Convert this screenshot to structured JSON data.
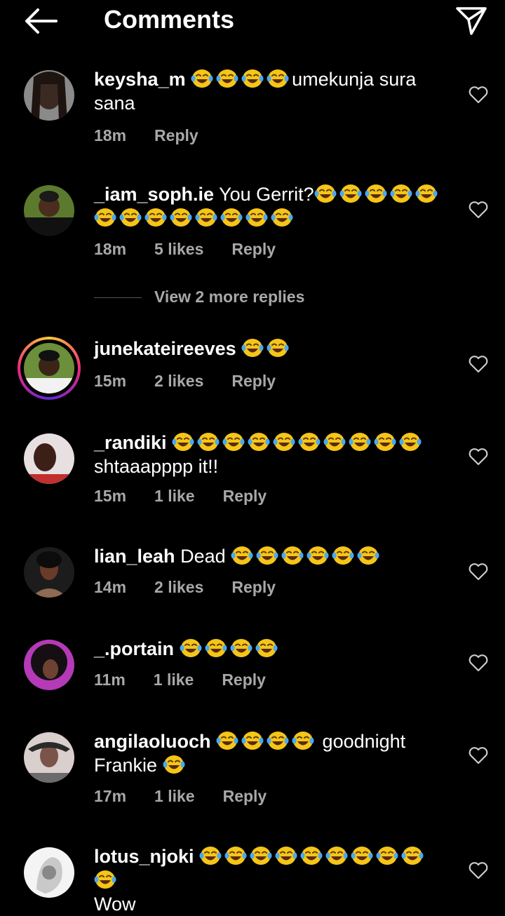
{
  "header": {
    "title": "Comments",
    "back_icon": "arrow-left-icon",
    "send_icon": "paper-plane-icon"
  },
  "comments": [
    {
      "user": "keysha_m",
      "pre": "",
      "emoji": 4,
      "text": "umekunja sura",
      "line2": "sana",
      "line2_emoji": 0,
      "time": "18m",
      "likes": "",
      "reply": "Reply"
    },
    {
      "user": "_iam_soph.ie",
      "pre": "You Gerrit?",
      "emoji": 5,
      "text": "",
      "line2": "",
      "line2_emoji": 8,
      "time": "18m",
      "likes": "5 likes",
      "reply": "Reply"
    },
    {
      "user": "junekateireeves",
      "pre": "",
      "emoji": 2,
      "text": "",
      "line2": "",
      "line2_emoji": 0,
      "time": "15m",
      "likes": "2 likes",
      "reply": "Reply"
    },
    {
      "user": "_randiki",
      "pre": "",
      "emoji": 10,
      "text": "",
      "line2": "shtaaapppp it!!",
      "line2_emoji": 0,
      "time": "15m",
      "likes": "1 like",
      "reply": "Reply"
    },
    {
      "user": "lian_leah",
      "pre": "Dead",
      "emoji": 6,
      "text": "",
      "line2": "",
      "line2_emoji": 0,
      "time": "14m",
      "likes": "2 likes",
      "reply": "Reply"
    },
    {
      "user": "_.portain",
      "pre": "",
      "emoji": 4,
      "text": "",
      "line2": "",
      "line2_emoji": 0,
      "time": "11m",
      "likes": "1 like",
      "reply": "Reply"
    },
    {
      "user": "angilaoluoch",
      "pre": "",
      "emoji": 4,
      "text": "goodnight",
      "line2": "Frankie",
      "line2_emoji": 1,
      "time": "17m",
      "likes": "1 like",
      "reply": "Reply"
    },
    {
      "user": "lotus_njoki",
      "pre": "",
      "emoji": 10,
      "text": "",
      "line2": "Wow",
      "line2_emoji": 0,
      "time": "",
      "likes": "",
      "reply": ""
    }
  ],
  "view_more": "View 2 more replies",
  "colors": {
    "background": "#000000",
    "meta": "#a8a8a8",
    "emoji": "#f5c518",
    "tears": "#4aa8f0"
  }
}
